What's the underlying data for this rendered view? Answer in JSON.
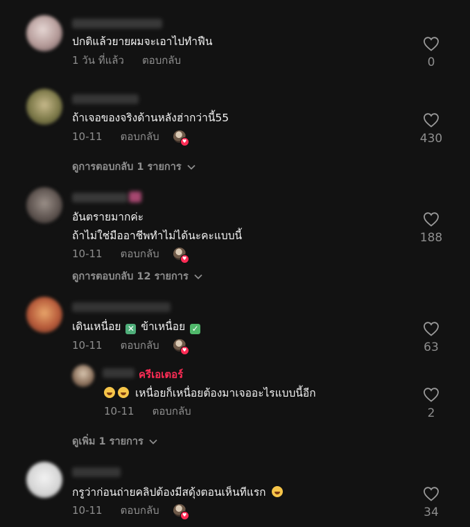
{
  "ui": {
    "reply_label": "ตอบกลับ"
  },
  "comments": [
    {
      "text_lines": [
        "ปกติแล้วยายผมจะเอาไปทำฟืน"
      ],
      "time": "1 วัน ที่แล้ว",
      "likes": "0",
      "creator_liked": false
    },
    {
      "text_lines": [
        "ถ้าเจอของจริงด้านหลังฮ่ากว่านี้55"
      ],
      "time": "10-11",
      "likes": "430",
      "creator_liked": true,
      "view_replies": "ดูการตอบกลับ 1 รายการ"
    },
    {
      "text_lines": [
        "อันตรายมากค่ะ",
        "ถ้าไม่ใช่มืออาชีพทำไม่ได้นะคะแบบนี้"
      ],
      "time": "10-11",
      "likes": "188",
      "creator_liked": true,
      "view_replies": "ดูการตอบกลับ 12 รายการ"
    },
    {
      "text_parts": [
        "เดินเหนื่อย",
        "ข้าเหนื่อย"
      ],
      "time": "10-11",
      "likes": "63",
      "creator_liked": true
    },
    {
      "text_lines": [
        "กรูว่าก่อนถ่ายคลิปต้องมีสดุ้งตอนเห็นทีแรก"
      ],
      "time": "10-11",
      "likes": "34",
      "creator_liked": true
    }
  ],
  "reply": {
    "badge": "ครีเอเตอร์",
    "text": "เหนื่อยก็เหนื่อยต้องมาเจออะไรแบบนี้อีก",
    "time": "10-11",
    "likes": "2",
    "view_more": "ดูเพิ่ม 1 รายการ"
  },
  "icons": {
    "like": "heart-outline-icon",
    "chevron": "chevron-down-icon",
    "x_emoji": "cross-mark-button-emoji",
    "check_emoji": "check-mark-button-emoji",
    "laugh_emoji": "grinning-squinting-face-emoji",
    "rofl_emoji": "rolling-on-floor-laughing-emoji"
  },
  "colors": {
    "background": "#121212",
    "accent": "#fe2c55",
    "muted": "#8e8e8e"
  }
}
